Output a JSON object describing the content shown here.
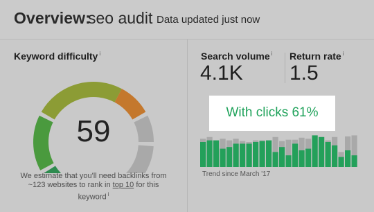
{
  "header": {
    "title": "Overview:",
    "query": "seo audit",
    "updated": "Data updated just now"
  },
  "keyword_difficulty": {
    "label": "Keyword difficulty",
    "info": "i",
    "value": "59",
    "score": 59,
    "estimate_before": "We estimate that you'll need backlinks from ~123 websites to rank in",
    "estimate_link": "top 10",
    "estimate_after": "for this keyword",
    "info_link": "i",
    "colors": {
      "dark_green": "#2e8b4f",
      "green": "#4a9a3e",
      "yellow_green": "#8c9c35",
      "orange": "#c4782d",
      "inactive": "#a9a9a9",
      "gap": "#c9c9c9"
    }
  },
  "search_volume": {
    "label": "Search volume",
    "info": "i",
    "value": "4.1K"
  },
  "return_rate": {
    "label": "Return rate",
    "info": "i",
    "value": "1.5"
  },
  "clicks": {
    "text": "With clicks 61%",
    "color": "#21a35c"
  },
  "trend": {
    "caption": "Trend since March '17",
    "total_color": "#a9a9a9",
    "clicks_color": "#23a05a",
    "bars": [
      {
        "total": 0.85,
        "clicks": 0.75
      },
      {
        "total": 0.9,
        "clicks": 0.8
      },
      {
        "total": 0.8,
        "clicks": 0.8
      },
      {
        "total": 0.85,
        "clicks": 0.55
      },
      {
        "total": 0.8,
        "clicks": 0.6
      },
      {
        "total": 0.85,
        "clicks": 0.7
      },
      {
        "total": 0.78,
        "clicks": 0.7
      },
      {
        "total": 0.75,
        "clicks": 0.7
      },
      {
        "total": 0.8,
        "clicks": 0.75
      },
      {
        "total": 0.8,
        "clicks": 0.78
      },
      {
        "total": 0.8,
        "clicks": 0.8
      },
      {
        "total": 0.9,
        "clicks": 0.45
      },
      {
        "total": 0.78,
        "clicks": 0.6
      },
      {
        "total": 0.82,
        "clicks": 0.35
      },
      {
        "total": 0.82,
        "clicks": 0.7
      },
      {
        "total": 0.88,
        "clicks": 0.5
      },
      {
        "total": 0.85,
        "clicks": 0.55
      },
      {
        "total": 0.95,
        "clicks": 0.95
      },
      {
        "total": 0.9,
        "clicks": 0.9
      },
      {
        "total": 0.8,
        "clicks": 0.75
      },
      {
        "total": 0.9,
        "clicks": 0.65
      },
      {
        "total": 0.45,
        "clicks": 0.3
      },
      {
        "total": 0.92,
        "clicks": 0.5
      },
      {
        "total": 0.95,
        "clicks": 0.35
      }
    ]
  }
}
